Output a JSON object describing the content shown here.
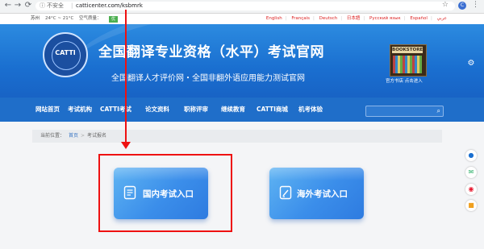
{
  "browser": {
    "back": "←",
    "forward": "→",
    "reload": "⟳",
    "insecure_label": "不安全",
    "separator": "|",
    "url": "catticenter.com/ksbmrk",
    "star": "☆",
    "menu": "⋮",
    "account_initial": "C"
  },
  "top_info": {
    "city": "苏州",
    "weather": "24°C ~ 21°C",
    "air_quality_label": "空气质量：",
    "air_quality_value": "优",
    "languages": [
      "English",
      "Français",
      "Deutsch",
      "日本語",
      "Русский язык",
      "Español",
      "عربي"
    ],
    "language_separator": "|"
  },
  "header": {
    "logo_text": "CATTI",
    "title": "全国翻译专业资格（水平）考试官网",
    "subtitle": "全国翻译人才评价网・全国非翻外语应用能力测试官网",
    "bookstore_sign": "BOOKSTORE",
    "bookstore_label": "官方书店 点击进入"
  },
  "nav": {
    "items": [
      "网站首页",
      "考试机构",
      "CATTI考试",
      "论文资料",
      "职称评审",
      "继续教育",
      "CATTI商城",
      "机考体验"
    ],
    "search_placeholder": ""
  },
  "breadcrumb": {
    "label": "当前位置：",
    "home": "首页",
    "separator": ">",
    "current": "考试报名"
  },
  "cards": {
    "domestic": "国内考试入口",
    "overseas": "海外考试入口"
  },
  "colors": {
    "banner": "#1f6ec9",
    "card": "#3b8eea",
    "annotation": "#e11111"
  }
}
